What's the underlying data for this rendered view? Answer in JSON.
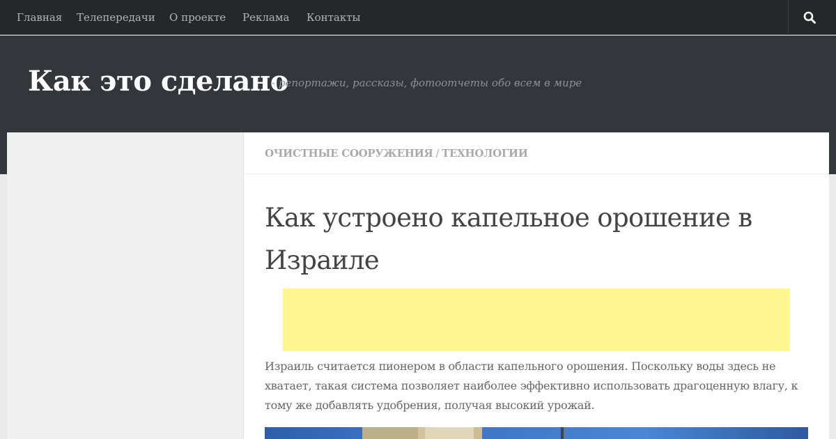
{
  "nav": {
    "items": [
      "Главная",
      "Телепередачи",
      "О проекте",
      "Реклама",
      "Контакты"
    ],
    "search_icon": "search-icon"
  },
  "header": {
    "title": "Как это сделано",
    "description": "- репортажи, рассказы, фотоотчеты обо всем в мире"
  },
  "breadcrumb": {
    "cat1": "ОЧИСТНЫЕ СООРУЖЕНИЯ",
    "sep": "/",
    "cat2": "ТЕХНОЛОГИИ"
  },
  "post": {
    "title": "Как устроено капельное орошение в Израиле",
    "text": "Израиль считается пионером в области капельного орошения. Поскольку воды здесь не хватает, такая система позволяет наиболее эффективно использовать драгоценную влагу, к тому же добавлять удобрения, получая высокий урожай."
  },
  "colors": {
    "nav_bg": "#26272b",
    "header_bg": "#33363b",
    "ad_bg": "#fff68f"
  }
}
